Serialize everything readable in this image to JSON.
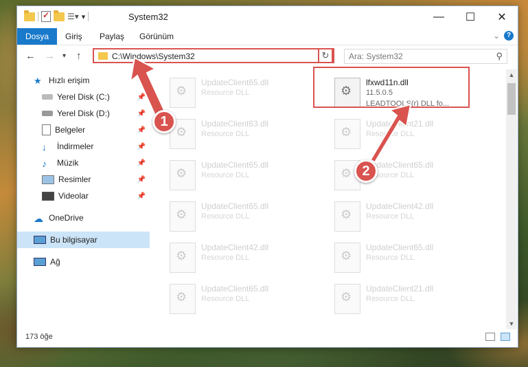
{
  "window": {
    "title": "System32",
    "minimize": "—",
    "maximize": "☐",
    "close": "✕"
  },
  "ribbon": {
    "tabs": [
      "Dosya",
      "Giriş",
      "Paylaş",
      "Görünüm"
    ]
  },
  "nav": {
    "address": "C:\\Windows\\System32",
    "search_placeholder": "Ara: System32"
  },
  "sidebar": {
    "items": [
      {
        "label": "Hızlı erişim",
        "icon": "star-icon"
      },
      {
        "label": "Yerel Disk (C:)",
        "icon": "drive-icon"
      },
      {
        "label": "Yerel Disk (D:)",
        "icon": "drive-icon"
      },
      {
        "label": "Belgeler",
        "icon": "documents-icon"
      },
      {
        "label": "İndirmeler",
        "icon": "downloads-icon"
      },
      {
        "label": "Müzik",
        "icon": "music-icon"
      },
      {
        "label": "Resimler",
        "icon": "pictures-icon"
      },
      {
        "label": "Videolar",
        "icon": "videos-icon"
      },
      {
        "label": "OneDrive",
        "icon": "cloud-icon"
      },
      {
        "label": "Bu bilgisayar",
        "icon": "computer-icon"
      },
      {
        "label": "Ağ",
        "icon": "network-icon"
      }
    ]
  },
  "files": {
    "highlighted": {
      "name": "lfxwd11n.dll",
      "version": "11.5.0.5",
      "desc": "LEADTOOLS(r) DLL fo..."
    },
    "left": [
      {
        "name": "UpdateClient65.dll",
        "type": "Resource DLL"
      },
      {
        "name": "UpdateClient63.dll",
        "type": "Resource DLL"
      },
      {
        "name": "UpdateClient65.dll",
        "type": "Resource DLL"
      },
      {
        "name": "UpdateClient65.dll",
        "type": "Resource DLL"
      },
      {
        "name": "UpdateClient42.dll",
        "type": "Resource DLL"
      },
      {
        "name": "UpdateClient65.dll",
        "type": "Resource DLL"
      }
    ],
    "right": [
      {
        "name": "UpdateClient21.dll",
        "type": "Resource DLL"
      },
      {
        "name": "UpdateClient65.dll",
        "type": "Resource DLL"
      },
      {
        "name": "UpdateClient42.dll",
        "type": "Resource DLL"
      },
      {
        "name": "UpdateClient65.dll",
        "type": "Resource DLL"
      },
      {
        "name": "UpdateClient21.dll",
        "type": "Resource DLL"
      }
    ]
  },
  "status": {
    "item_count": "173 öğe"
  },
  "annotations": {
    "step1": "1",
    "step2": "2"
  }
}
